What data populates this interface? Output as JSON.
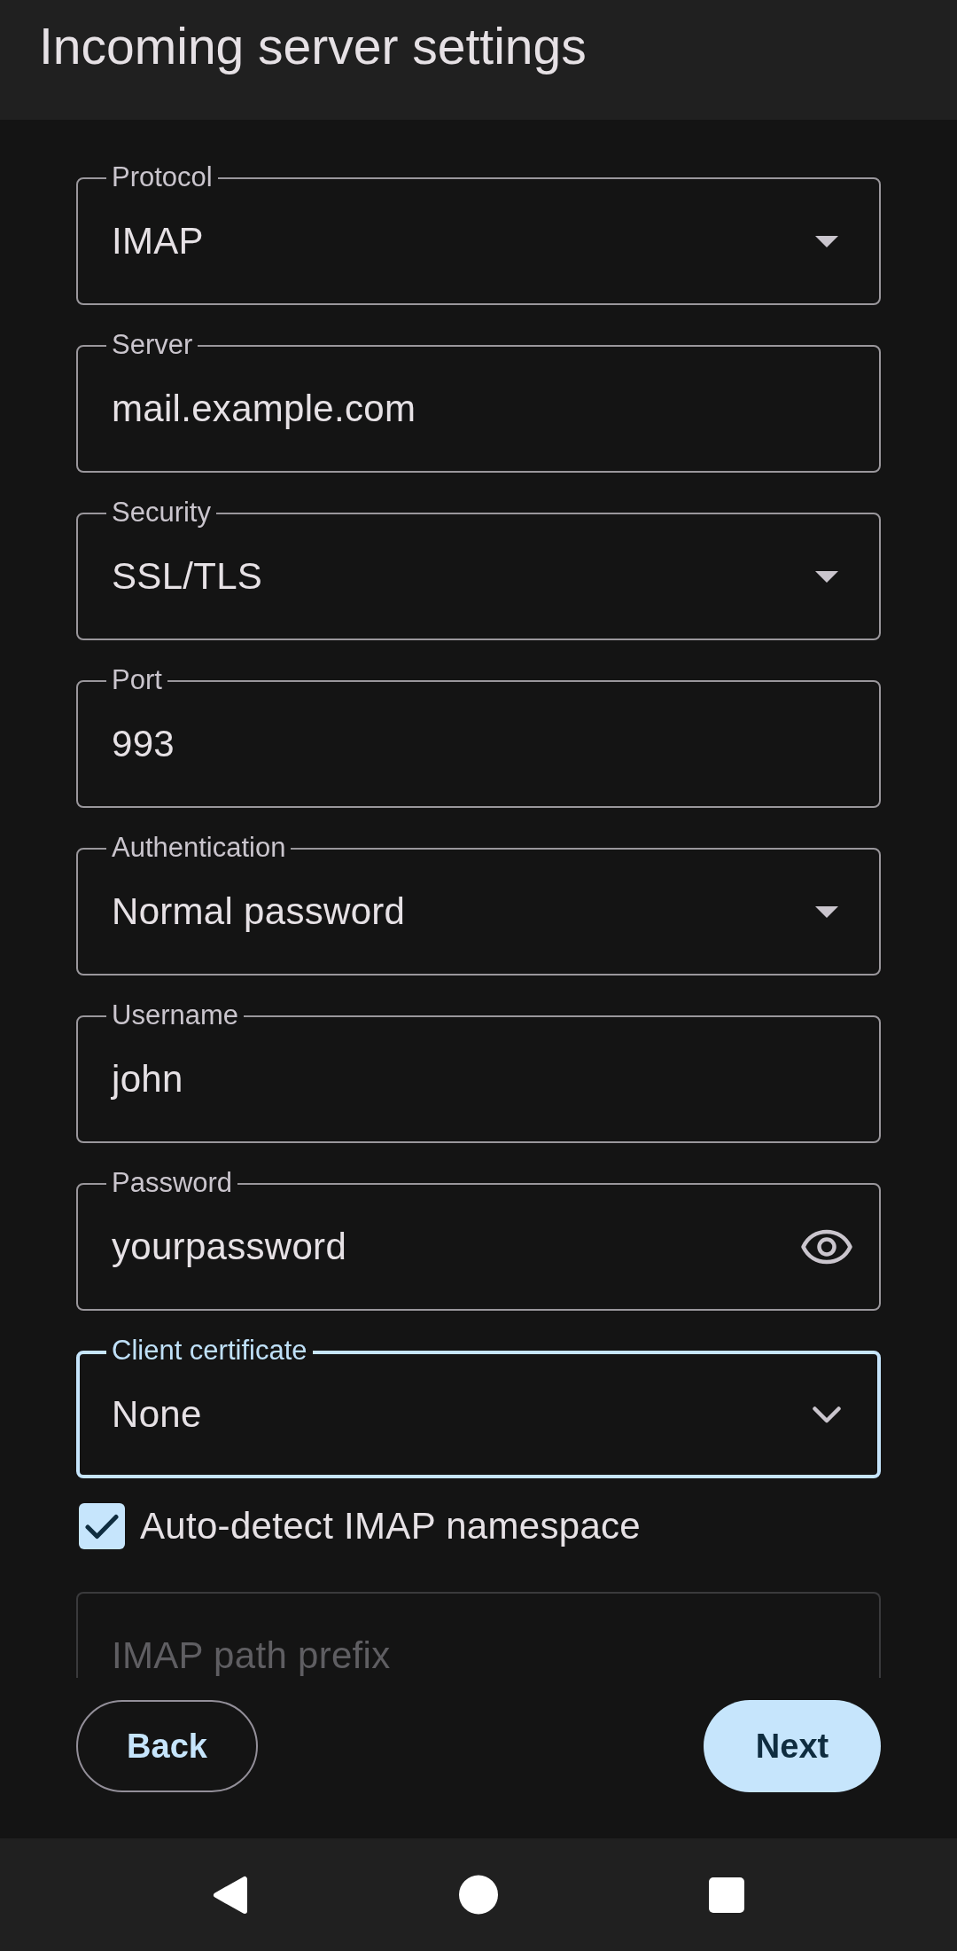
{
  "app_bar": {
    "title": "Incoming server settings"
  },
  "fields": [
    {
      "kind": "select",
      "label": "Protocol",
      "value": "IMAP",
      "focused": false
    },
    {
      "kind": "text",
      "label": "Server",
      "value": "mail.example.com",
      "focused": false
    },
    {
      "kind": "select",
      "label": "Security",
      "value": "SSL/TLS",
      "focused": false
    },
    {
      "kind": "text",
      "label": "Port",
      "value": "993",
      "focused": false
    },
    {
      "kind": "select",
      "label": "Authentication",
      "value": "Normal password",
      "focused": false
    },
    {
      "kind": "text",
      "label": "Username",
      "value": "john",
      "focused": false
    },
    {
      "kind": "password",
      "label": "Password",
      "value": "yourpassword",
      "focused": false
    },
    {
      "kind": "picker",
      "label": "Client certificate",
      "value": "None",
      "focused": true
    }
  ],
  "namespace_checkbox": {
    "label": "Auto-detect IMAP namespace",
    "checked": true
  },
  "path_prefix_field": {
    "label": "IMAP path prefix",
    "disabled": true
  },
  "buttons": [
    {
      "kind": "outlined",
      "label": "Back"
    },
    {
      "kind": "filled",
      "label": "Next"
    }
  ]
}
